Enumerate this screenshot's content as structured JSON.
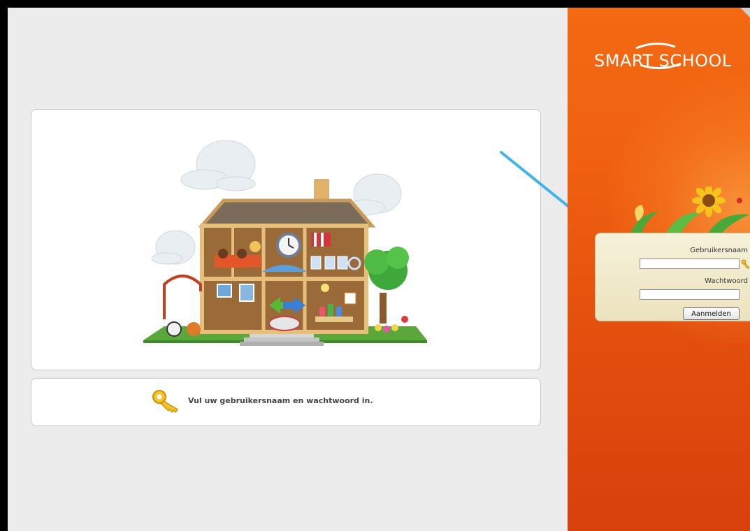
{
  "brand": {
    "name": "SMART SCHOOL"
  },
  "login": {
    "username_label": "Gebruikersnaam",
    "username_value": "",
    "password_label": "Wachtwoord",
    "password_value": "",
    "submit_label": "Aanmelden"
  },
  "message": {
    "text": "Vul uw gebruikersnaam en wachtwoord in."
  },
  "icons": {
    "key": "key-icon",
    "house": "school-house-illustration",
    "sunflower": "sunflower-decoration",
    "arrow": "arrow-annotation"
  },
  "colors": {
    "orange_panel": "#f06010",
    "login_bg": "#f3edd2",
    "arrow": "#3fb4e6"
  }
}
